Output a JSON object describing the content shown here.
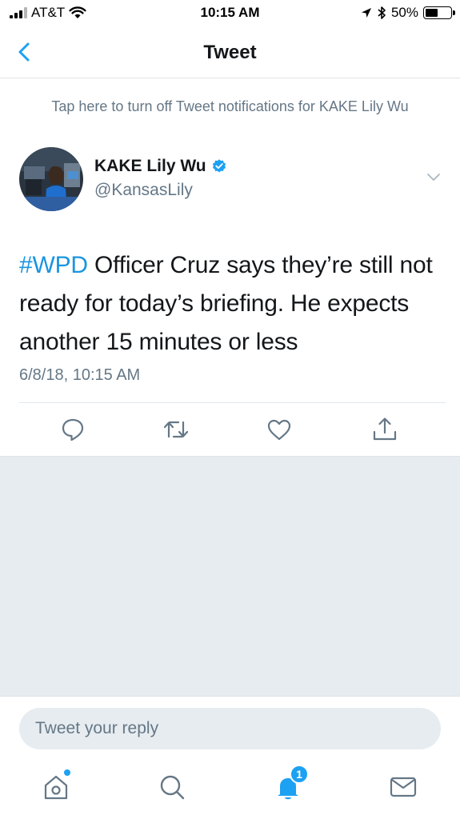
{
  "status_bar": {
    "carrier": "AT&T",
    "time": "10:15 AM",
    "battery_percent": "50%",
    "battery_level": 0.5,
    "signal_bars_filled": 3,
    "icons": [
      "signal-icon",
      "wifi-icon",
      "location-arrow-icon",
      "bluetooth-icon",
      "battery-icon"
    ]
  },
  "nav": {
    "title": "Tweet",
    "back_icon": "chevron-left-icon"
  },
  "notification_banner": {
    "text": "Tap here to turn off Tweet notifications for KAKE Lily Wu"
  },
  "tweet": {
    "author_name": "KAKE Lily Wu",
    "author_handle": "@KansasLily",
    "verified": true,
    "hashtag": "#WPD",
    "text_body": " Officer Cruz says they’re still not ready for today’s briefing. He expects another 15 minutes or less",
    "timestamp": "6/8/18, 10:15 AM",
    "actions": [
      "reply-icon",
      "retweet-icon",
      "like-icon",
      "share-icon"
    ]
  },
  "reply": {
    "placeholder": "Tweet your reply"
  },
  "tab_bar": {
    "tabs": [
      "home-icon",
      "search-icon",
      "notifications-icon",
      "messages-icon"
    ],
    "notifications_badge": "1"
  },
  "colors": {
    "accent": "#1da1f2",
    "hashtag": "#1b95e0",
    "secondary_text": "#657786",
    "background_grey": "#e6ecf0"
  }
}
